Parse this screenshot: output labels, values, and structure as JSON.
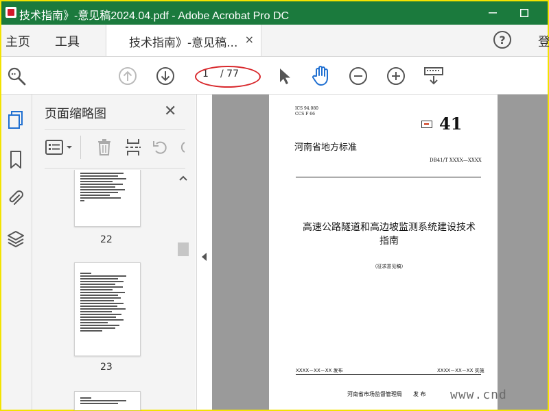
{
  "window": {
    "title": "技术指南》-意见稿2024.04.pdf - Adobe Acrobat Pro DC"
  },
  "menu": {
    "home": "主页",
    "tools": "工具",
    "doc_tab": "技术指南》-意见稿...",
    "doc_tab_close": "×",
    "login": "登"
  },
  "toolbar": {
    "current_page": "1",
    "total_pages": "/ 77",
    "highlight_color": "#d8272b"
  },
  "thumbnails": {
    "panel_title": "页面缩略图",
    "close": "✕",
    "pages": [
      {
        "label": "22"
      },
      {
        "label": "23"
      }
    ]
  },
  "document": {
    "ics": "ICS  94.080",
    "ccs": "CCS  F 66",
    "number": "41",
    "std_label": "河南省地方标准",
    "code": "DB41/T XXXX—XXXX",
    "title_line1": "高速公路隧道和高边坡监测系统建设技术",
    "title_line2": "指南",
    "subtitle": "（征求意见稿）",
    "publish_date": "XXXX－XX－XX 发布",
    "effective_date": "XXXX－XX－XX 实施",
    "issuer": "河南省市场监督管理局　　发 布"
  },
  "watermark": {
    "text": "www.cnd"
  },
  "colors": {
    "titlebar": "#1b7a3d",
    "frame": "#f3e300",
    "viewer_bg": "#9a9a9a"
  }
}
